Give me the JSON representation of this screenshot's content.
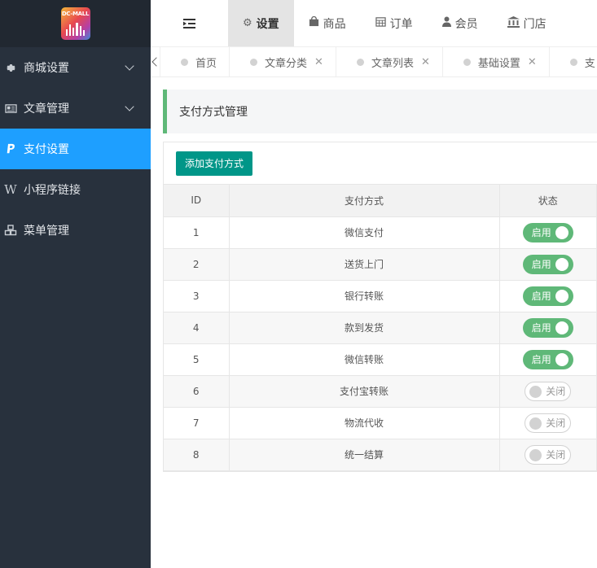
{
  "app": {
    "logo_text": "DC-MALL"
  },
  "sidebar": {
    "items": [
      {
        "label": "商城设置",
        "icon": "gear-icon"
      },
      {
        "label": "文章管理",
        "icon": "newspaper-icon"
      },
      {
        "label": "支付设置",
        "icon": "paypal-icon"
      },
      {
        "label": "小程序链接",
        "icon": "wordpress-icon"
      },
      {
        "label": "菜单管理",
        "icon": "cubes-icon"
      }
    ]
  },
  "topnav": {
    "tabs": [
      {
        "label": "设置",
        "icon": "gears-icon"
      },
      {
        "label": "商品",
        "icon": "shopping-bag-icon"
      },
      {
        "label": "订单",
        "icon": "calendar-icon"
      },
      {
        "label": "会员",
        "icon": "user-icon"
      },
      {
        "label": "门店",
        "icon": "bank-icon"
      }
    ]
  },
  "page_tabs": [
    {
      "label": "首页"
    },
    {
      "label": "文章分类"
    },
    {
      "label": "文章列表"
    },
    {
      "label": "基础设置"
    },
    {
      "label": "支"
    }
  ],
  "main": {
    "title": "支付方式管理",
    "add_button": "添加支付方式",
    "columns": [
      "ID",
      "支付方式",
      "状态"
    ],
    "switch_on_label": "启用",
    "switch_off_label": "关闭",
    "rows": [
      {
        "id": "1",
        "method": "微信支付",
        "enabled": true
      },
      {
        "id": "2",
        "method": "送货上门",
        "enabled": true
      },
      {
        "id": "3",
        "method": "银行转账",
        "enabled": true
      },
      {
        "id": "4",
        "method": "款到发货",
        "enabled": true
      },
      {
        "id": "5",
        "method": "微信转账",
        "enabled": true
      },
      {
        "id": "6",
        "method": "支付宝转账",
        "enabled": false
      },
      {
        "id": "7",
        "method": "物流代收",
        "enabled": false
      },
      {
        "id": "8",
        "method": "统一结算",
        "enabled": false
      }
    ]
  },
  "colors": {
    "sidebar_bg": "#28313d",
    "active_nav": "#1e9fff",
    "switch_on": "#5fb878",
    "button": "#009688"
  }
}
